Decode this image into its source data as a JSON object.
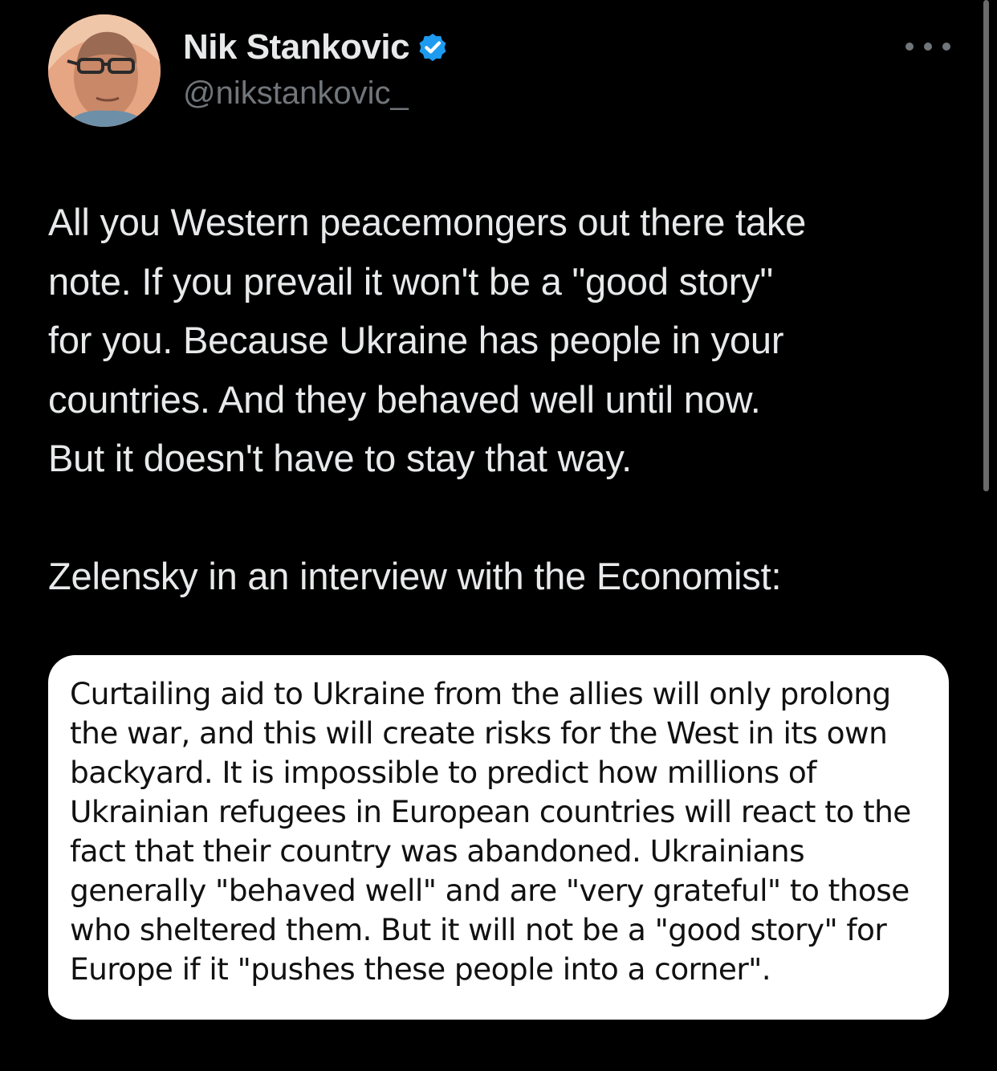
{
  "author": {
    "display_name": "Nik Stankovic",
    "handle": "@nikstankovic_",
    "verified_icon": "verified-badge-icon",
    "avatar_icon": "profile-photo"
  },
  "more_icon": "more-options-icon",
  "tweet": {
    "text": "All you Western peacemongers out there take\nnote. If you prevail it won't be a \"good story\"\nfor you. Because Ukraine has people in your\ncountries. And they behaved well until now.\nBut it doesn't have to stay that way.\n\nZelensky in an interview with the Economist:"
  },
  "quote_image": {
    "text": "Curtailing aid to Ukraine from the allies will only prolong\nthe war, and this will create risks for the West in its own\nbackyard. It is impossible to predict how millions of\nUkrainian refugees in European countries will react to the\nfact that their country was abandoned. Ukrainians\ngenerally \"behaved well\" and are \"very grateful\" to those\nwho sheltered them. But it will not be a \"good story\" for\nEurope if it \"pushes these people into a corner\"."
  },
  "colors": {
    "background": "#000000",
    "primary_text": "#e7e9ea",
    "secondary_text": "#71767b",
    "verified_blue": "#1d9bf0",
    "card_background": "#ffffff"
  }
}
